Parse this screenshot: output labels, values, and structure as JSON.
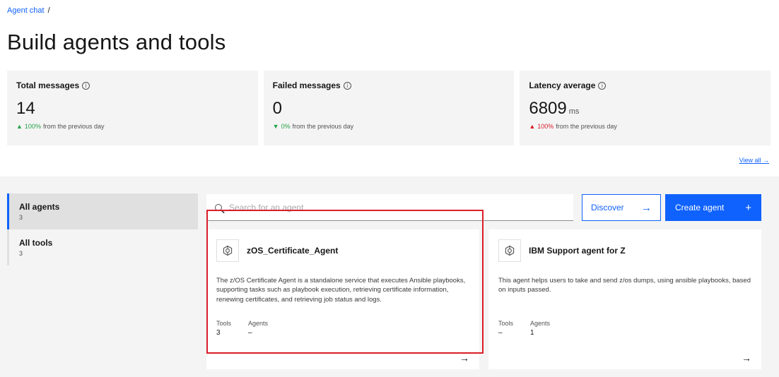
{
  "breadcrumb": {
    "link": "Agent chat",
    "separator": "/"
  },
  "page": {
    "title": "Build agents and tools"
  },
  "metrics": [
    {
      "label": "Total messages",
      "value": "14",
      "unit": "",
      "trend_arrow": "▲",
      "trend_pct": "100%",
      "trend_text": "from the previous day",
      "trend_color": "#24a148"
    },
    {
      "label": "Failed messages",
      "value": "0",
      "unit": "",
      "trend_arrow": "▼",
      "trend_pct": "0%",
      "trend_text": "from the previous day",
      "trend_color": "#24a148"
    },
    {
      "label": "Latency average",
      "value": "6809",
      "unit": "ms",
      "trend_arrow": "▲",
      "trend_pct": "100%",
      "trend_text": "from the previous day",
      "trend_color": "#da1e28"
    }
  ],
  "view_all": "View all →",
  "sidebar": {
    "items": [
      {
        "label": "All agents",
        "count": "3",
        "active": true
      },
      {
        "label": "All tools",
        "count": "3",
        "active": false
      }
    ]
  },
  "search": {
    "placeholder": "Search for an agent"
  },
  "buttons": {
    "discover": "Discover",
    "discover_icon": "→",
    "create": "Create agent",
    "create_icon": "+"
  },
  "cards": [
    {
      "title": "zOS_Certificate_Agent",
      "description": "The z/OS Certificate Agent is a standalone service that executes Ansible playbooks,  supporting tasks such as playbook execution, retrieving certificate information, renewing certificates, and retrieving job status and logs.",
      "tools_label": "Tools",
      "tools_value": "3",
      "agents_label": "Agents",
      "agents_value": "–",
      "arrow": "→"
    },
    {
      "title": "IBM Support agent for Z",
      "description": "This agent helps users to take and send z/os dumps, using ansible playbooks, based on inputs passed.",
      "tools_label": "Tools",
      "tools_value": "–",
      "agents_label": "Agents",
      "agents_value": "1",
      "arrow": "→"
    }
  ],
  "colors": {
    "accent": "#0f62fe",
    "highlight": "#da1e28",
    "positive": "#24a148"
  }
}
